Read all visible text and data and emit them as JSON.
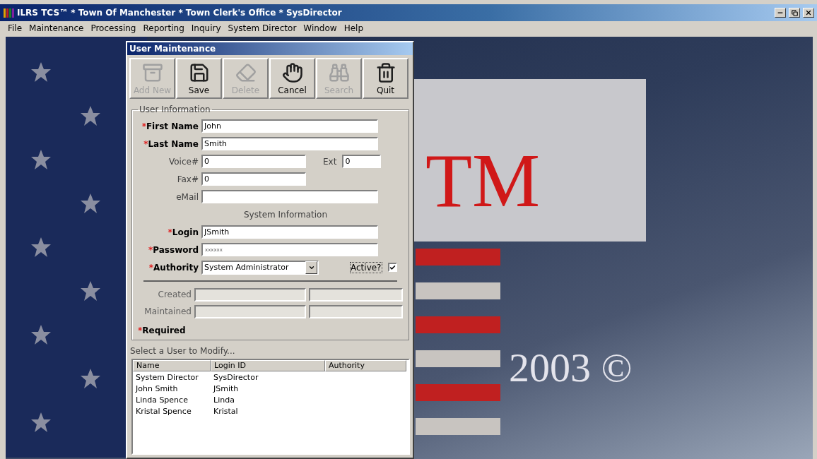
{
  "app_window": {
    "title": "ILRS TCS™ * Town Of Manchester * Town Clerk's Office * SysDirector"
  },
  "menu": [
    "File",
    "Maintenance",
    "Processing",
    "Reporting",
    "Inquiry",
    "System Director",
    "Window",
    "Help"
  ],
  "desktop": {
    "trademark": "TM",
    "year": "2003 ©"
  },
  "dialog": {
    "title": "User Maintenance",
    "toolbar": [
      {
        "label": "Add New",
        "kind": "cabinet",
        "disabled": true
      },
      {
        "label": "Save",
        "kind": "disk",
        "disabled": false
      },
      {
        "label": "Delete",
        "kind": "eraser",
        "disabled": true
      },
      {
        "label": "Cancel",
        "kind": "hand",
        "disabled": false
      },
      {
        "label": "Search",
        "kind": "binoculars",
        "disabled": true
      },
      {
        "label": "Quit",
        "kind": "trash",
        "disabled": false
      }
    ],
    "user_information": {
      "legend": "User Information",
      "required_mark": "*",
      "fields": [
        {
          "kind": "wide",
          "label": "First Name",
          "value": "John",
          "required": true
        },
        {
          "kind": "wide",
          "label": "Last Name",
          "value": "Smith",
          "required": true
        },
        {
          "kind": "narrow",
          "label": "Voice#",
          "value": "0",
          "required": false,
          "ext": {
            "label": "Ext",
            "value": "0"
          }
        },
        {
          "kind": "narrow",
          "label": "Fax#",
          "value": "0",
          "required": false
        },
        {
          "kind": "wide",
          "label": "eMail",
          "required": false
        },
        {
          "kind": "heading",
          "label": "System Information"
        },
        {
          "kind": "wide",
          "label": "Login",
          "value": "JSmith",
          "required": true
        },
        {
          "kind": "password",
          "label": "Password",
          "value": "xxxxxx",
          "required": true
        },
        {
          "kind": "select",
          "label": "Authority",
          "value": "System Administrator",
          "required": true,
          "checkbox": {
            "label": "Active?",
            "checked": true
          }
        }
      ]
    },
    "audit": [
      {
        "label": "Created"
      },
      {
        "label": "Maintained"
      }
    ],
    "required_note": "Required",
    "list": {
      "label": "Select a User to Modify...",
      "columns": [
        "Name",
        "Login ID",
        "Authority"
      ],
      "rows": [
        [
          "System Director",
          "SysDirector"
        ],
        [
          "John  Smith",
          "JSmith"
        ],
        [
          "Linda Spence",
          "Linda"
        ],
        [
          "Kristal Spence",
          "Kristal"
        ]
      ]
    }
  }
}
